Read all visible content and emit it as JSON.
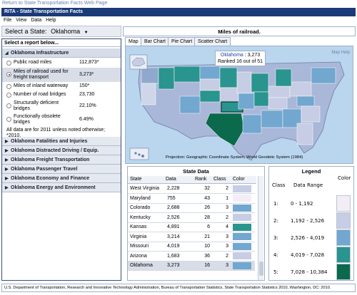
{
  "top_link": "Return to State Transportation Facts Web Page",
  "window_title": "RITA - State Transportation Facts",
  "menu": [
    "File",
    "View",
    "Data",
    "Help"
  ],
  "select_state": {
    "label": "Select a State:",
    "value": "Oklahoma"
  },
  "header_title": "Miles of railroad.",
  "left_panel": {
    "heading": "Select a report below...",
    "expanded_section": "Oklahoma Infrastructure",
    "items": [
      {
        "label": "Public road miles",
        "value": "112,873*",
        "selected": false
      },
      {
        "label": "Miles of railroad used for freight transport",
        "value": "3,273*",
        "selected": true
      },
      {
        "label": "Miles of inland waterway",
        "value": "150*",
        "selected": false
      },
      {
        "label": "Number of road bridges",
        "value": "23,730",
        "selected": false
      },
      {
        "label": "Structurally deficient bridges",
        "value": "22.10%",
        "selected": false
      },
      {
        "label": "Functionally obsolete bridges",
        "value": "6.49%",
        "selected": false
      }
    ],
    "note": "All data are for 2011 unless noted otherwise; *2010.",
    "sections": [
      "Oklahoma Fatalities and Injuries",
      "Oklahoma Distracted Driving / Equip.",
      "Oklahoma Freight Transportation",
      "Oklahoma Passenger Travel",
      "Oklahoma Economy and Finance",
      "Oklahoma Energy and Environment"
    ]
  },
  "tabs": [
    "Map",
    "Bar Chart",
    "Pie Chart",
    "Scatter Chart"
  ],
  "map": {
    "state_name": "Oklahoma",
    "state_value": "3,273",
    "rank_text": "Ranked 16 out of 51",
    "help": "Map Help",
    "projection": "Projection: Geographic Coordinate System, World Geodetic System (1984)"
  },
  "state_data": {
    "title": "State Data",
    "columns": [
      "State",
      "Data",
      "Rank",
      "Class",
      "Color"
    ],
    "rows": [
      {
        "state": "West Virginia",
        "data": "2,228",
        "rank": "32",
        "class": "2",
        "color": "#c6cde4"
      },
      {
        "state": "Maryland",
        "data": "755",
        "rank": "43",
        "class": "1",
        "color": "#f3eef6"
      },
      {
        "state": "Colorado",
        "data": "2,688",
        "rank": "26",
        "class": "3",
        "color": "#72a7cf"
      },
      {
        "state": "Kentucky",
        "data": "2,526",
        "rank": "28",
        "class": "2",
        "color": "#c6cde4"
      },
      {
        "state": "Kansas",
        "data": "4,891",
        "rank": "6",
        "class": "4",
        "color": "#2a948f"
      },
      {
        "state": "Virginia",
        "data": "3,214",
        "rank": "21",
        "class": "3",
        "color": "#72a7cf"
      },
      {
        "state": "Missouri",
        "data": "4,019",
        "rank": "10",
        "class": "3",
        "color": "#72a7cf"
      },
      {
        "state": "Arizona",
        "data": "1,683",
        "rank": "36",
        "class": "2",
        "color": "#c6cde4"
      },
      {
        "state": "Oklahoma",
        "data": "3,273",
        "rank": "16",
        "class": "3",
        "color": "#72a7cf"
      }
    ]
  },
  "legend": {
    "title": "Legend",
    "columns": [
      "Class",
      "Data Range",
      "Color"
    ],
    "rows": [
      {
        "class": "1:",
        "range": "0 - 1,192",
        "color": "#f3eef6"
      },
      {
        "class": "2:",
        "range": "1,192 - 2,526",
        "color": "#c6cde4"
      },
      {
        "class": "3:",
        "range": "2,526 - 4,019",
        "color": "#72a7cf"
      },
      {
        "class": "4:",
        "range": "4,019 - 7,028",
        "color": "#2a948f"
      },
      {
        "class": "5:",
        "range": "7,028 - 10,384",
        "color": "#0b6a4c"
      }
    ]
  },
  "footer": "U.S. Department of Transportation, Research and Innovative Technology Administration, Bureau of Transportation Statistics, State Transportation Statistics 2010, Washington, DC: 2010."
}
